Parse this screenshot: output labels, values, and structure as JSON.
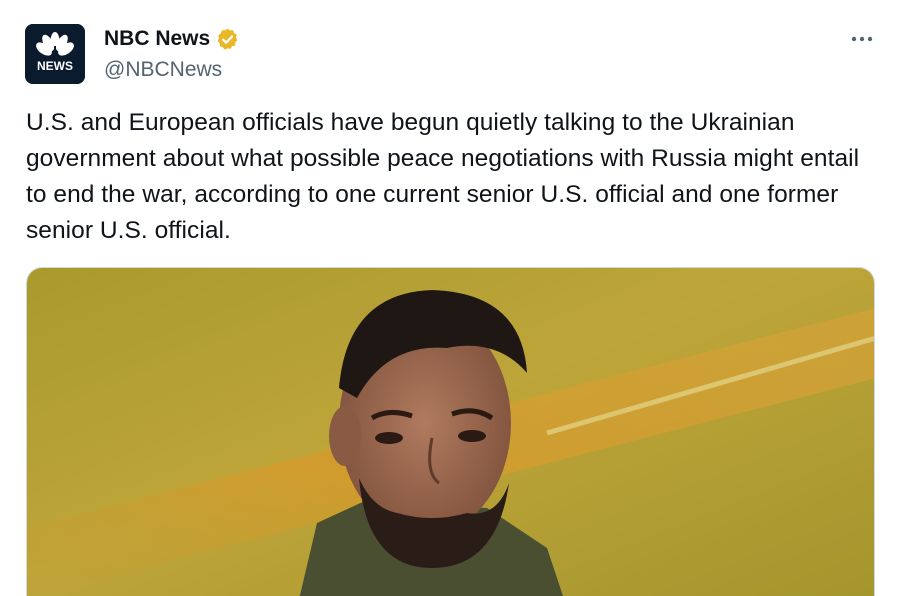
{
  "author": {
    "display_name": "NBC News",
    "handle": "@NBCNews",
    "avatar_text": "NEWS",
    "verified_badge": "gold-verified-icon"
  },
  "tweet": {
    "text": "U.S. and European officials have begun quietly talking to the Ukrainian government about what possible peace negotiations with Russia might entail to end the war, according to one current senior U.S. official and one former senior U.S. official."
  },
  "media": {
    "kind": "photo"
  },
  "icons": {
    "more": "more-options-icon"
  },
  "colors": {
    "verified_gold": "#e8b829",
    "handle_gray": "#536471",
    "text": "#0f1419"
  }
}
